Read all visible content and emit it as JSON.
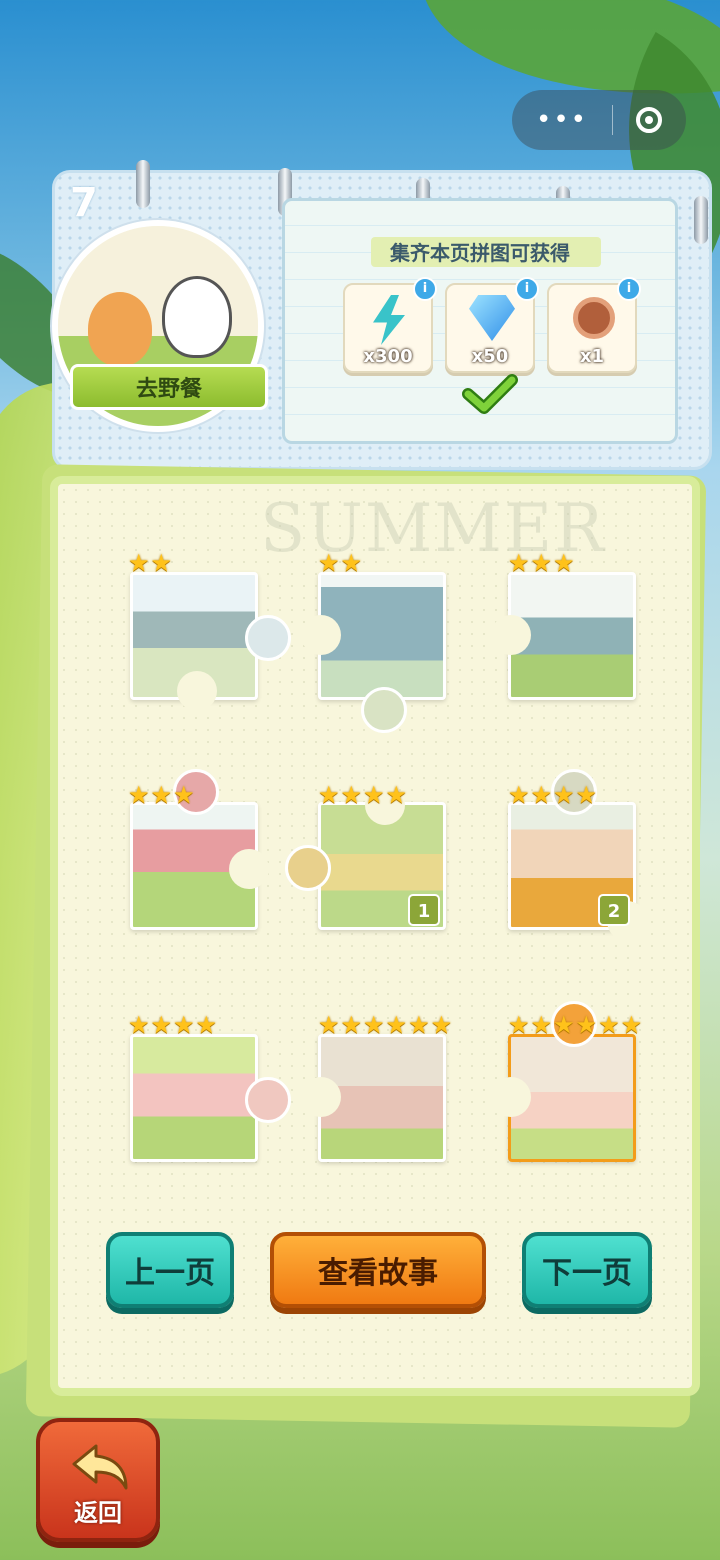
{
  "capsule": {
    "more_icon": "more-dots-icon",
    "close_icon": "target-circle-icon"
  },
  "page_number": "7",
  "badge": {
    "title": "去野餐"
  },
  "reward": {
    "title": "集齐本页拼图可获得",
    "items": [
      {
        "icon": "lightning-bolt-icon",
        "amount": "x300",
        "color": "#39c3c9"
      },
      {
        "icon": "diamond-icon",
        "amount": "x50",
        "color": "#2f8ee8"
      },
      {
        "icon": "stopwatch-icon",
        "amount": "x1",
        "color": "#b15f3b"
      }
    ],
    "info_label": "i",
    "claimed": true
  },
  "book": {
    "watermark": "SUMMER"
  },
  "pieces": [
    {
      "stars": 2,
      "count": null
    },
    {
      "stars": 2,
      "count": null
    },
    {
      "stars": 3,
      "count": null
    },
    {
      "stars": 3,
      "count": null
    },
    {
      "stars": 4,
      "count": "1"
    },
    {
      "stars": 4,
      "count": "2"
    },
    {
      "stars": 4,
      "count": null
    },
    {
      "stars": 6,
      "count": null
    },
    {
      "stars": 6,
      "count": null
    }
  ],
  "buttons": {
    "prev": "上一页",
    "story": "查看故事",
    "next": "下一页"
  },
  "back": {
    "label": "返回"
  },
  "colors": {
    "teal": "#1fb7a8",
    "orange": "#f07a12",
    "star": "#ffc21a",
    "badge_green": "#8ca638"
  }
}
